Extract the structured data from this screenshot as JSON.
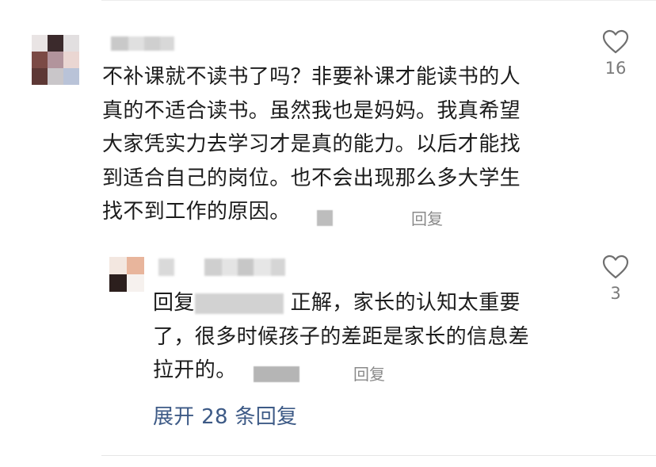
{
  "comment": {
    "text_line1": "不补课就不读书了吗？非要补课才能读书的人",
    "text_line2": "真的不适合读书。虽然我也是妈妈。我真希望",
    "text_line3": "大家凭实力去学习才是真的能力。以后才能找",
    "text_line4": "到适合自己的岗位。也不会出现那么多大学生",
    "text_line5": "找不到工作的原因。",
    "reply_label": "回复",
    "like_count": "16",
    "like_icon": "heart-outline-icon"
  },
  "reply": {
    "prefix": "回复",
    "text_after_mention": " 正解，家长的认知太重要",
    "text_line2": "了，很多时候孩子的差距是家长的信息差",
    "text_line3": "拉开的。",
    "reply_label": "回复",
    "like_count": "3",
    "like_icon": "heart-outline-icon"
  },
  "expand": {
    "label": "展开 28 条回复"
  },
  "colors": {
    "text": "#1c1c1c",
    "muted": "#8a8a8a",
    "link": "#3d5a86",
    "divider": "#ececec"
  }
}
